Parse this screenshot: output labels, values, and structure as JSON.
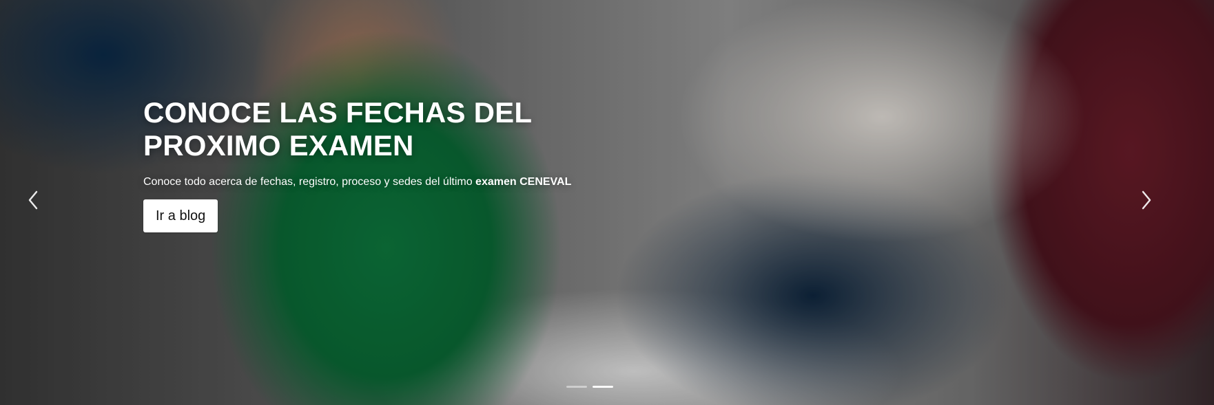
{
  "hero": {
    "title_line1": "CONOCE LAS FECHAS DEL",
    "title_line2": "PROXIMO EXAMEN",
    "subtitle_prefix": "Conoce todo acerca de fechas, registro, proceso y sedes del último ",
    "subtitle_strong": "examen CENEVAL",
    "cta_label": "Ir a blog"
  },
  "carousel": {
    "prev_icon": "chevron-left-icon",
    "next_icon": "chevron-right-icon",
    "active_index": 1,
    "indicator_count": 2
  }
}
